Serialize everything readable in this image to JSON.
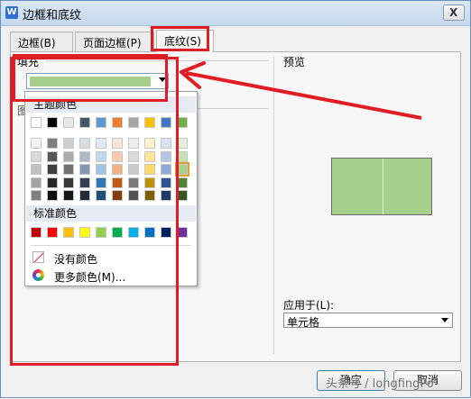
{
  "window": {
    "title": "边框和底纹",
    "close_label": "X"
  },
  "tabs": [
    {
      "label": "边框(B)"
    },
    {
      "label": "页面边框(P)"
    },
    {
      "label": "底纹(S)"
    }
  ],
  "shading": {
    "fill_label": "填充",
    "fill_value_color": "#a8d08d",
    "pattern_label": "图"
  },
  "palette": {
    "theme_header": "主题颜色",
    "standard_header": "标准颜色",
    "theme_colors": [
      "#ffffff",
      "#000000",
      "#e7e6e6",
      "#44546a",
      "#5b9bd5",
      "#ed7d31",
      "#a5a5a5",
      "#ffc000",
      "#4472c4",
      "#70ad47"
    ],
    "theme_shades": [
      [
        "#f2f2f2",
        "#7f7f7f",
        "#d0cece",
        "#d6dce4",
        "#deebf6",
        "#fbe5d5",
        "#ededed",
        "#fff2cc",
        "#d9e2f3",
        "#e2efd9"
      ],
      [
        "#d8d8d8",
        "#595959",
        "#aeabab",
        "#adb9ca",
        "#bdd7ee",
        "#f7cbac",
        "#dbdbdb",
        "#fee599",
        "#b4c6e7",
        "#c5e0b3"
      ],
      [
        "#bfbfbf",
        "#3f3f3f",
        "#757070",
        "#8496b0",
        "#9cc3e5",
        "#f4b083",
        "#c9c9c9",
        "#ffd965",
        "#8eaadb",
        "#a8d08d"
      ],
      [
        "#a5a5a5",
        "#262626",
        "#3a3838",
        "#323f4f",
        "#2e75b5",
        "#c45911",
        "#7b7b7b",
        "#bf9000",
        "#2f5496",
        "#538135"
      ],
      [
        "#7f7f7f",
        "#0c0c0c",
        "#171616",
        "#222a35",
        "#1e4e79",
        "#833c0b",
        "#525252",
        "#7f6000",
        "#1f3864",
        "#375623"
      ]
    ],
    "standard_colors": [
      "#c00000",
      "#ff0000",
      "#ffc000",
      "#ffff00",
      "#92d050",
      "#00b050",
      "#00b0f0",
      "#0070c0",
      "#002060",
      "#7030a0"
    ],
    "no_color_label": "没有颜色",
    "more_colors_label": "更多颜色(M)..."
  },
  "preview": {
    "label": "预览",
    "fill_color": "#a8d08d"
  },
  "apply_to": {
    "label": "应用于(L):",
    "value": "单元格"
  },
  "buttons": {
    "ok": "确定",
    "cancel": "取消"
  },
  "watermark": "头条号 / longfingPo",
  "annotation_color": "#e01c24"
}
